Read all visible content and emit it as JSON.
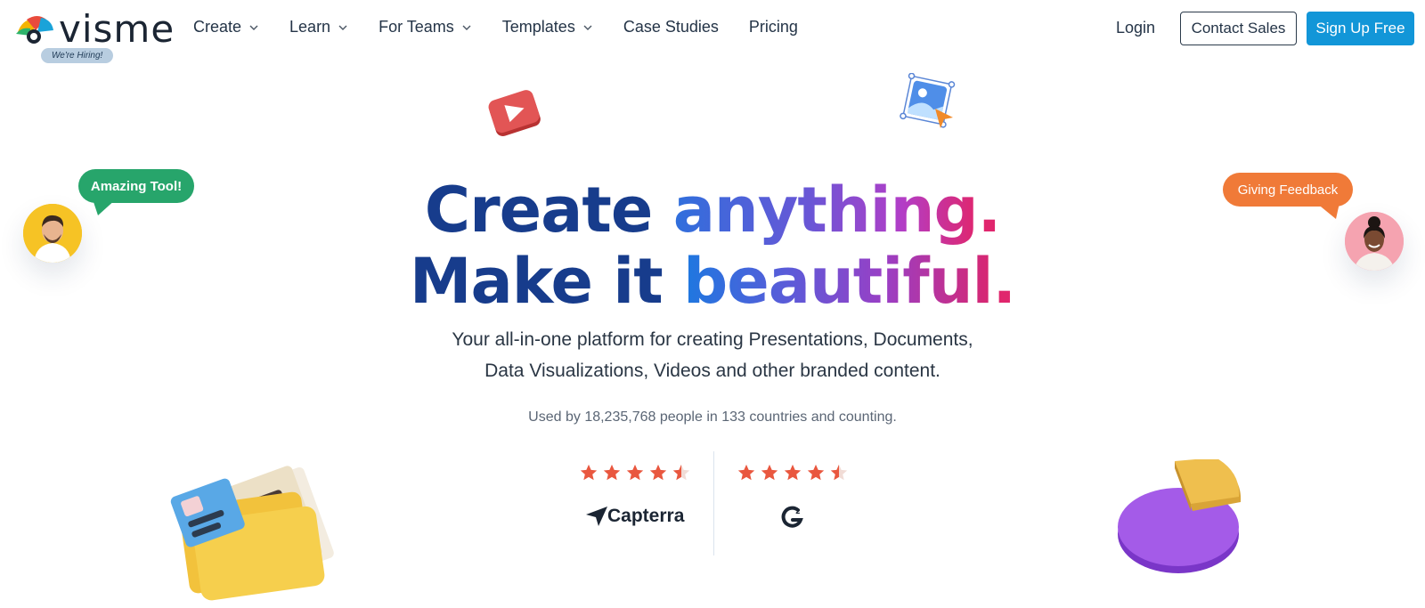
{
  "brand": {
    "name": "visme",
    "hiring_badge": "We're Hiring!"
  },
  "nav": {
    "items": [
      {
        "label": "Create",
        "has_dropdown": true
      },
      {
        "label": "Learn",
        "has_dropdown": true
      },
      {
        "label": "For Teams",
        "has_dropdown": true
      },
      {
        "label": "Templates",
        "has_dropdown": true
      },
      {
        "label": "Case Studies",
        "has_dropdown": false
      },
      {
        "label": "Pricing",
        "has_dropdown": false
      }
    ],
    "login": "Login",
    "contact_sales": "Contact Sales",
    "sign_up": "Sign Up Free"
  },
  "hero": {
    "line1_a": "Create",
    "line1_b": "anything",
    "line2_a": "Make it",
    "line2_b": "beautiful",
    "period": ".",
    "subtitle_line1": "Your all-in-one platform for creating Presentations, Documents,",
    "subtitle_line2": "Data Visualizations, Videos and other branded content.",
    "used_by": "Used by 18,235,768 people in 133 countries and counting."
  },
  "ratings": [
    {
      "source": "Capterra",
      "stars": 4.5
    },
    {
      "source": "G2",
      "stars": 4.5
    }
  ],
  "bubbles": {
    "left": "Amazing Tool!",
    "right": "Giving Feedback"
  },
  "colors": {
    "accent_blue": "#1296d8",
    "headline_dark": "#173c8c",
    "headline_pink": "#e0266d",
    "star": "#e9573f",
    "bubble_green": "#27a56b",
    "bubble_orange": "#f07a38"
  }
}
